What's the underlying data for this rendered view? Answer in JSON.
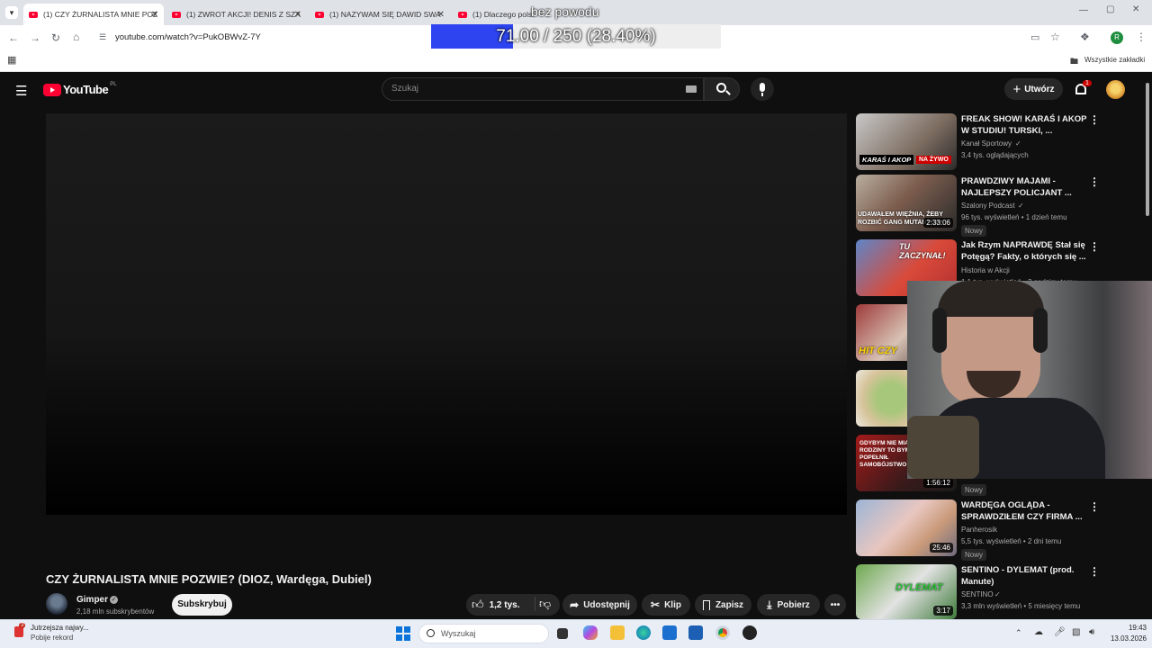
{
  "browser": {
    "tabs": [
      {
        "title": "(1) CZY ŻURNALISTA MNIE POZ",
        "active": true
      },
      {
        "title": "(1) ZWROT AKCJI! DENIS Z SZA",
        "active": false
      },
      {
        "title": "(1) NAZYWAM SIĘ DAWID SWA",
        "active": false
      },
      {
        "title": "(1) Dlaczego polski",
        "active": false
      }
    ],
    "url": "youtube.com/watch?v=PukOBWvZ-7Y",
    "bookmarks_label": "Wszystkie zakładki",
    "profile_initial": "R"
  },
  "overlay": {
    "title": "bez powodu",
    "progress_text": "71.00 / 250 (28.40%)",
    "progress_fraction": 0.284,
    "progress_color": "#2d44f0"
  },
  "youtube": {
    "logo_text": "YouTube",
    "region": "PL",
    "search_placeholder": "Szukaj",
    "create_label": "Utwórz",
    "notifications_count": "1",
    "video": {
      "title": "CZY ŻURNALISTA MNIE POZWIE? (DIOZ, Wardęga, Dubiel)",
      "channel": "Gimper",
      "subscribers": "2,18 mln subskrybentów",
      "subscribe_label": "Subskrybuj",
      "likes": "1,2 tys.",
      "share_label": "Udostępnij",
      "clip_label": "Klip",
      "save_label": "Zapisz",
      "download_label": "Pobierz"
    },
    "recommendations": [
      {
        "title": "FREAK SHOW! KARAŚ I AKOP W STUDIU! TURSKI, ...",
        "channel": "Kanał Sportowy",
        "verified": true,
        "meta": "3,4 tys. oglądających",
        "thumb_text": "KARAŚ I AKOP",
        "badge": "NA ŻYWO",
        "duration": "",
        "new": false
      },
      {
        "title": "PRAWDZIWY MAJAMI - NAJLEPSZY POLICJANT ...",
        "channel": "Szalony Podcast",
        "verified": true,
        "meta": "96 tys. wyświetleń • 1 dzień temu",
        "thumb_text": "UDAWAŁEM WIĘŹNIA, ŻEBY ROZBIĆ GANG MUTANTÓW",
        "duration": "2:33:06",
        "new": true
      },
      {
        "title": "Jak Rzym NAPRAWDĘ Stał się Potęgą? Fakty, o których się ...",
        "channel": "Historia w Akcji",
        "verified": false,
        "meta": "1,1 tys. wyświetleń • 3 godziny temu",
        "thumb_text": "TU ZACZYNAŁ!",
        "duration": "",
        "new": false
      },
      {
        "title": "",
        "channel": "",
        "verified": false,
        "meta": "",
        "thumb_text": "HIT CZY",
        "duration": "",
        "new": false
      },
      {
        "title": "",
        "channel": "",
        "verified": false,
        "meta": "",
        "thumb_text": "",
        "duration": "",
        "new": false
      },
      {
        "title": "",
        "channel": "",
        "verified": false,
        "meta": "",
        "thumb_text": "GDYBYM NIE MIAŁ RODZINY TO BYM POPEŁNIŁ SAMOBÓJSTWO",
        "duration": "1:56:12",
        "new": true
      },
      {
        "title": "WARDĘGA OGLĄDA - SPRAWDZIŁEM CZY FIRMA ...",
        "channel": "Panherosik",
        "verified": false,
        "meta": "5,5 tys. wyświetleń • 2 dni temu",
        "thumb_text": "",
        "duration": "25:46",
        "new": true
      },
      {
        "title": "SENTINO - DYLEMAT (prod. Manute)",
        "channel": "SENTINO",
        "verified": true,
        "meta": "3,3 mln wyświetleń • 5 miesięcy temu",
        "thumb_text": "DYLEMAT",
        "duration": "3:17",
        "new": false
      }
    ],
    "new_label": "Nowy"
  },
  "taskbar": {
    "notification_count": "3",
    "news_title": "Jutrzejsza najwy...",
    "news_sub": "Pobije rekord",
    "search_placeholder": "Wyszukaj",
    "time": "19:43",
    "date": "13.03.2026"
  }
}
